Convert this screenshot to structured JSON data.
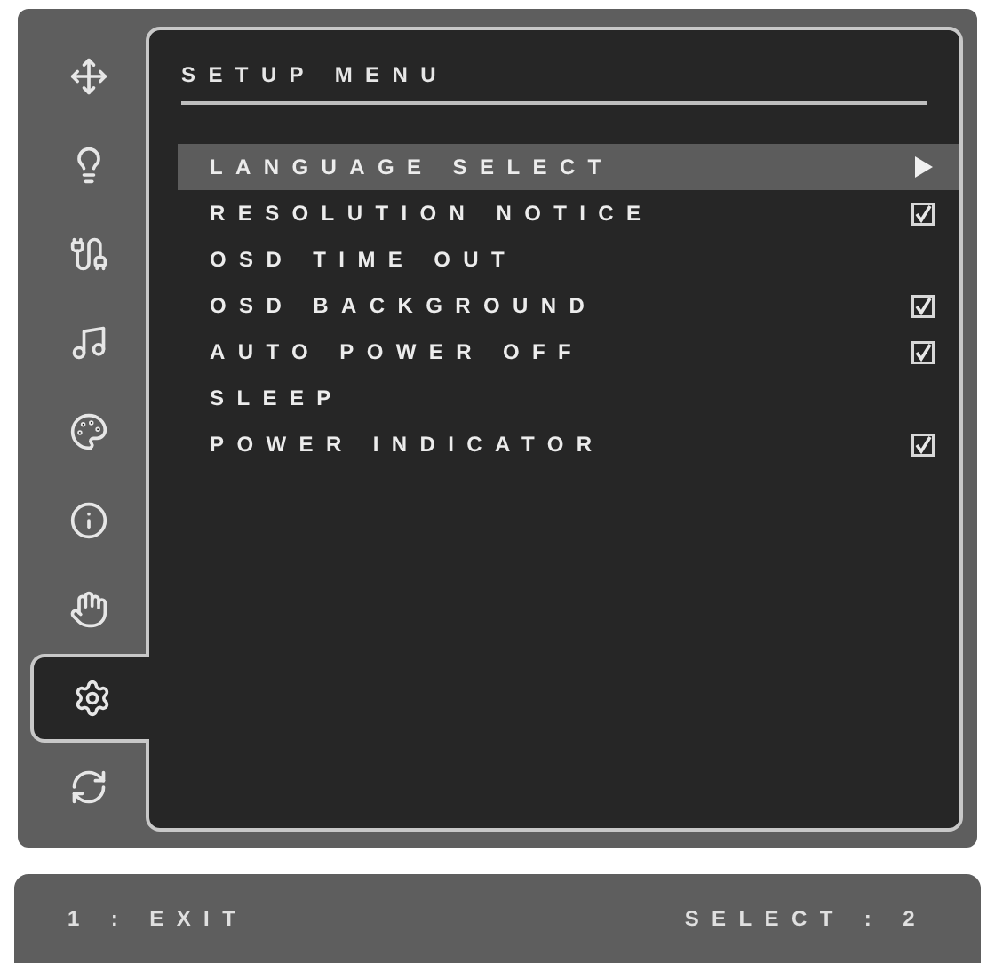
{
  "sidebar": {
    "items": [
      {
        "kind": "move",
        "selected": false
      },
      {
        "kind": "lightbulb",
        "selected": false
      },
      {
        "kind": "plug",
        "selected": false
      },
      {
        "kind": "music",
        "selected": false
      },
      {
        "kind": "palette",
        "selected": false
      },
      {
        "kind": "info",
        "selected": false
      },
      {
        "kind": "hand",
        "selected": false
      },
      {
        "kind": "gear",
        "selected": true
      },
      {
        "kind": "refresh",
        "selected": false
      }
    ]
  },
  "menu": {
    "title": "SETUP MENU",
    "items": [
      {
        "label": "LANGUAGE SELECT",
        "kind": "submenu",
        "selected": true
      },
      {
        "label": "RESOLUTION NOTICE",
        "kind": "checkbox",
        "checked": true,
        "selected": false
      },
      {
        "label": "OSD TIME OUT",
        "kind": "plain",
        "selected": false
      },
      {
        "label": "OSD BACKGROUND",
        "kind": "checkbox",
        "checked": true,
        "selected": false
      },
      {
        "label": "AUTO POWER OFF",
        "kind": "checkbox",
        "checked": true,
        "selected": false
      },
      {
        "label": "SLEEP",
        "kind": "plain",
        "selected": false
      },
      {
        "label": "POWER INDICATOR",
        "kind": "checkbox",
        "checked": true,
        "selected": false
      }
    ]
  },
  "status_bar": {
    "left": "1 : EXIT",
    "right": "SELECT : 2"
  }
}
